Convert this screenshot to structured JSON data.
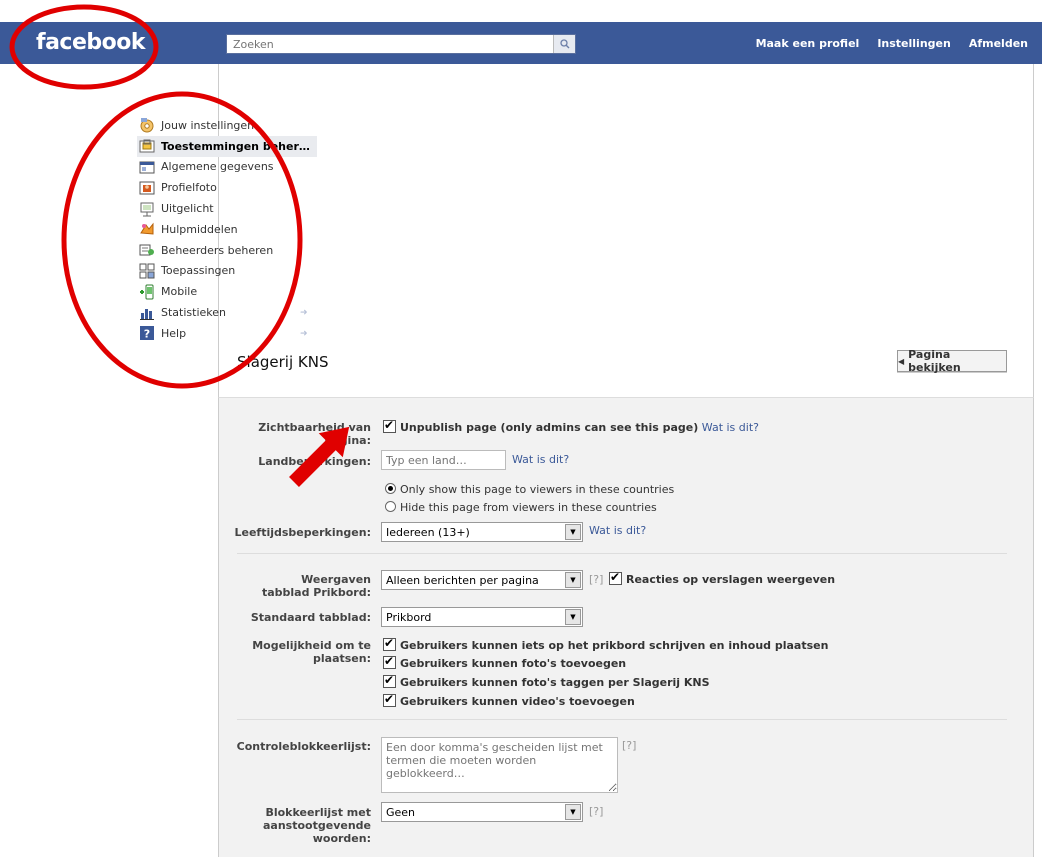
{
  "topbar": {
    "logo": "facebook",
    "search_placeholder": "Zoeken",
    "links": [
      "Maak een profiel",
      "Instellingen",
      "Afmelden"
    ]
  },
  "sidebar": {
    "items": [
      {
        "label": "Jouw instellingen",
        "icon": "settings-icon"
      },
      {
        "label": "Toestemmingen beher…",
        "icon": "permissions-icon"
      },
      {
        "label": "Algemene gegevens",
        "icon": "info-icon"
      },
      {
        "label": "Profielfoto",
        "icon": "photo-icon"
      },
      {
        "label": "Uitgelicht",
        "icon": "featured-icon"
      },
      {
        "label": "Hulpmiddelen",
        "icon": "tools-icon"
      },
      {
        "label": "Beheerders beheren",
        "icon": "admins-icon"
      },
      {
        "label": "Toepassingen",
        "icon": "apps-icon"
      },
      {
        "label": "Mobile",
        "icon": "mobile-icon"
      },
      {
        "label": "Statistieken",
        "icon": "stats-icon"
      },
      {
        "label": "Help",
        "icon": "help-icon"
      }
    ]
  },
  "page": {
    "title": "Slagerij KNS",
    "view_button": "Pagina bekijken"
  },
  "form": {
    "visibility": {
      "label": "Zichtbaarheid van pagina:",
      "checkbox_label": "Unpublish page (only admins can see this page)",
      "help_link": "Wat is dit?"
    },
    "country": {
      "label": "Landbeperkingen:",
      "placeholder": "Typ een land…",
      "help_link": "Wat is dit?",
      "option_show": "Only show this page to viewers in these countries",
      "option_hide": "Hide this page from viewers in these countries"
    },
    "age": {
      "label": "Leeftijdsbeperkingen:",
      "value": "Iedereen (13+)",
      "help_link": "Wat is dit?"
    },
    "wall_view": {
      "label": "Weergaven tabblad Prikbord:",
      "value": "Alleen berichten per pagina",
      "help": "[?]",
      "checkbox_label": "Reacties op verslagen weergeven"
    },
    "default_tab": {
      "label": "Standaard tabblad:",
      "value": "Prikbord"
    },
    "posting": {
      "label": "Mogelijkheid om te plaatsen:",
      "options": [
        "Gebruikers kunnen iets op het prikbord schrijven en inhoud plaatsen",
        "Gebruikers kunnen foto's toevoegen",
        "Gebruikers kunnen foto's taggen per Slagerij KNS",
        "Gebruikers kunnen video's toevoegen"
      ]
    },
    "moderation": {
      "label": "Controleblokkeerlijst:",
      "placeholder": "Een door komma's gescheiden lijst met termen die moeten worden geblokkeerd…",
      "help": "[?]"
    },
    "profanity": {
      "label": "Blokkeerlijst met aanstootgevende woorden:",
      "value": "Geen",
      "help": "[?]"
    }
  },
  "colors": {
    "brand": "#3b5998",
    "annotation": "#e00000"
  }
}
